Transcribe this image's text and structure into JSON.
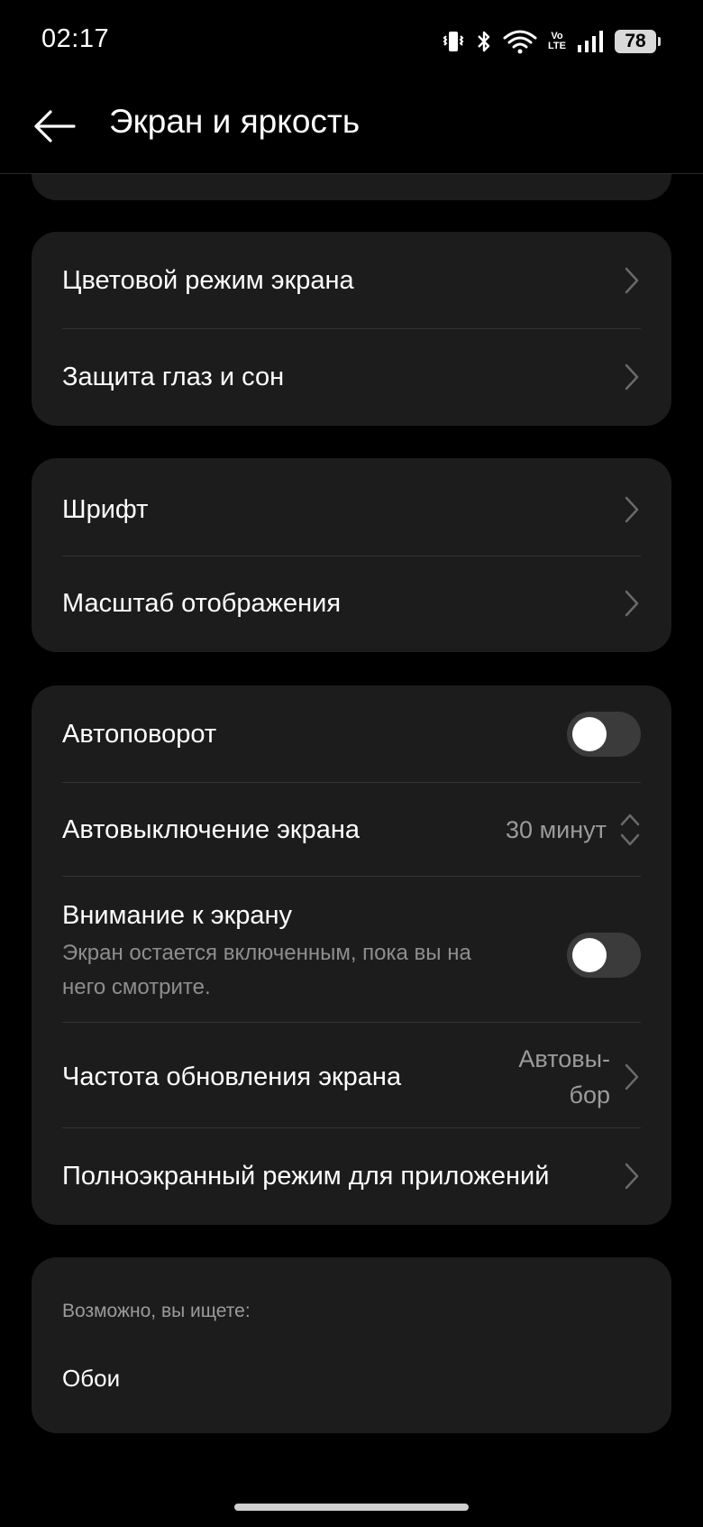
{
  "status_bar": {
    "time": "02:17",
    "icons": [
      "vibrate-icon",
      "bluetooth-icon",
      "wifi-icon",
      "volte-icon",
      "signal-icon",
      "battery-icon"
    ],
    "volte_top": "Vo",
    "volte_bottom": "LTE",
    "battery": "78"
  },
  "header": {
    "title": "Экран и яркость",
    "back_icon": "back-arrow-icon"
  },
  "group_color": {
    "items": [
      {
        "label": "Цветовой режим экрана"
      },
      {
        "label": "Защита глаз и сон"
      }
    ]
  },
  "group_font": {
    "items": [
      {
        "label": "Шрифт"
      },
      {
        "label": "Масштаб отображения"
      }
    ]
  },
  "group_screen": {
    "auto_rotate": {
      "label": "Автоповорот",
      "enabled": false
    },
    "screen_timeout": {
      "label": "Автовыключение экрана",
      "value": "30 минут"
    },
    "screen_attention": {
      "label": "Внимание к экрану",
      "description_line1": "Экран остается включенным, пока вы на",
      "description_line2": "него смотрите.",
      "enabled": false
    },
    "refresh_rate": {
      "label": "Частота обновления экрана",
      "value_line1": "Автовы-",
      "value_line2": "бор"
    },
    "fullscreen_apps": {
      "label": "Полноэкранный режим для приложений"
    }
  },
  "suggestions": {
    "heading": "Возможно, вы ищете:",
    "items": [
      {
        "label": "Обои"
      }
    ]
  },
  "colors": {
    "background": "#000000",
    "card": "#1c1c1c",
    "divider": "#333333",
    "secondary_text": "#9b9b9b",
    "toggle_track_off": "#3b3b3b"
  }
}
